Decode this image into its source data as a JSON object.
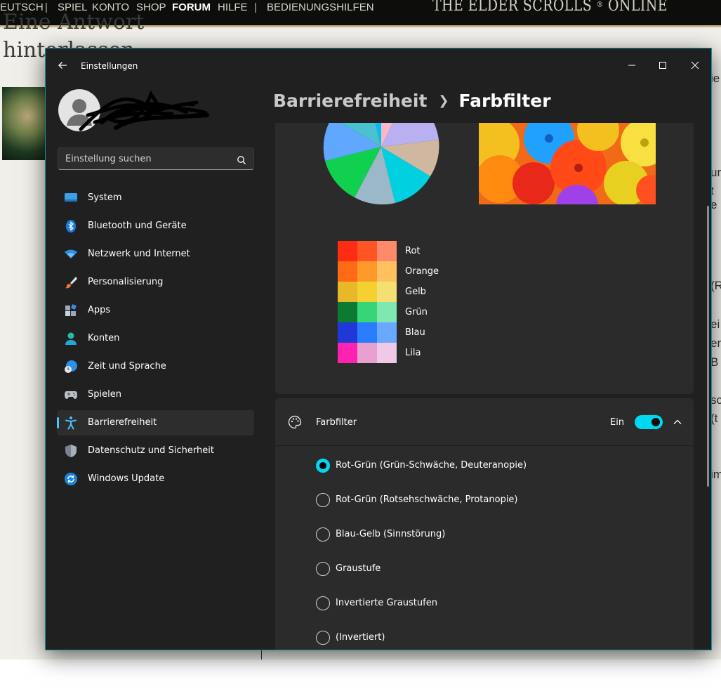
{
  "website": {
    "nav": [
      "EUTSCH",
      "|",
      "SPIEL",
      "KONTO",
      "SHOP",
      "FORUM",
      "HILFE",
      "|",
      "BEDIENUNGSHILFEN"
    ],
    "active_nav": "FORUM",
    "brand": "THE ELDER SCROLLS",
    "brand_mark": "®",
    "brand_suffix": "ONLINE",
    "heading_line1": "Eine Antwort",
    "heading_line2": "hinterlassen",
    "right_fragments": [
      "ie",
      "ur",
      "t e",
      "(R",
      "ei",
      "er",
      "B",
      "sc",
      "(t",
      "im"
    ]
  },
  "window": {
    "title": "Einstellungen",
    "back_icon": "arrow-left-icon",
    "controls": [
      "minimize-icon",
      "maximize-icon",
      "close-icon"
    ]
  },
  "search": {
    "placeholder": "Einstellung suchen"
  },
  "sidebar": {
    "items": [
      {
        "label": "System",
        "icon": "monitor-icon"
      },
      {
        "label": "Bluetooth und Geräte",
        "icon": "bluetooth-icon"
      },
      {
        "label": "Netzwerk und Internet",
        "icon": "wifi-icon"
      },
      {
        "label": "Personalisierung",
        "icon": "brush-icon"
      },
      {
        "label": "Apps",
        "icon": "apps-icon"
      },
      {
        "label": "Konten",
        "icon": "person-icon"
      },
      {
        "label": "Zeit und Sprache",
        "icon": "globe-clock-icon"
      },
      {
        "label": "Spielen",
        "icon": "gamepad-icon"
      },
      {
        "label": "Barrierefreiheit",
        "icon": "accessibility-icon",
        "selected": true
      },
      {
        "label": "Datenschutz und Sicherheit",
        "icon": "shield-icon"
      },
      {
        "label": "Windows Update",
        "icon": "update-icon"
      }
    ]
  },
  "breadcrumb": {
    "parent": "Barrierefreiheit",
    "current": "Farbfilter"
  },
  "swatches": [
    {
      "label": "Rot",
      "colors": [
        "#ff2b12",
        "#ff5522",
        "#ff8a6a"
      ]
    },
    {
      "label": "Orange",
      "colors": [
        "#ff6a14",
        "#ff9a2a",
        "#ffc060"
      ]
    },
    {
      "label": "Gelb",
      "colors": [
        "#e8b828",
        "#f4d030",
        "#f4e070"
      ]
    },
    {
      "label": "Grün",
      "colors": [
        "#0c7a30",
        "#38d478",
        "#7ee8b0"
      ]
    },
    {
      "label": "Blau",
      "colors": [
        "#2038d8",
        "#2a7cff",
        "#6aa8ff"
      ]
    },
    {
      "label": "Lila",
      "colors": [
        "#ff22b0",
        "#e8a0d0",
        "#f0c8e8"
      ]
    }
  ],
  "color_filter": {
    "title": "Farbfilter",
    "state_label": "Ein",
    "enabled": true,
    "options": [
      {
        "label": "Rot-Grün (Grün-Schwäche, Deuteranopie)",
        "checked": true
      },
      {
        "label": "Rot-Grün (Rotsehschwäche, Protanopie)",
        "checked": false
      },
      {
        "label": "Blau-Gelb (Sinnstörung)",
        "checked": false
      },
      {
        "label": "Graustufe",
        "checked": false
      },
      {
        "label": "Invertierte Graustufen",
        "checked": false
      },
      {
        "label": "(Invertiert)",
        "checked": false
      }
    ]
  },
  "colors": {
    "accent": "#00d7f0",
    "window_bg": "#202020",
    "card_bg": "#2b2b2b"
  }
}
